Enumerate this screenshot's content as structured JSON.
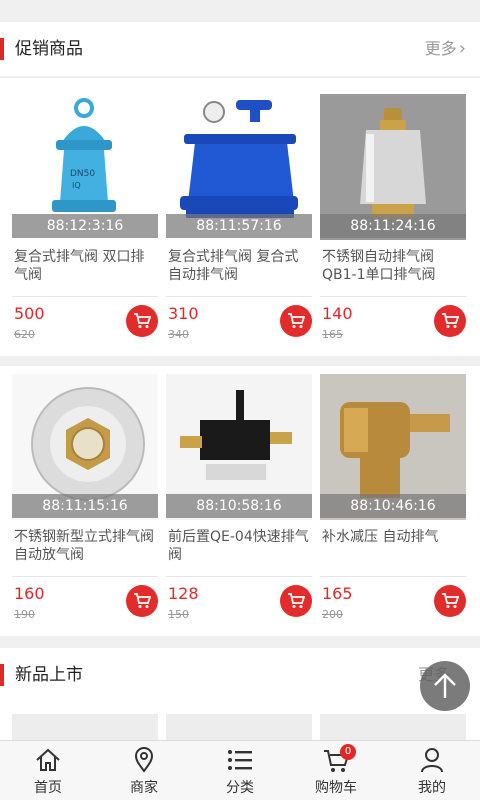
{
  "promo": {
    "title": "促销商品",
    "more": "更多",
    "items": [
      {
        "time": "88:11:57:16",
        "name": "复合式排气阀 复合式自动排气阀",
        "price": "310",
        "old_price": "340"
      },
      {
        "time": "88:11:24:16",
        "name": "不锈钢自动排气阀QB1-1单口排气阀",
        "price": "140",
        "old_price": "165"
      },
      {
        "time": "88:11:15:16",
        "name": "不锈钢新型立式排气阀自动放气阀",
        "price": "160",
        "old_price": "190"
      },
      {
        "time": "88:10:58:16",
        "name": "前后置QE-04快速排气阀",
        "price": "128",
        "old_price": "150"
      },
      {
        "time": "88:10:46:16",
        "name": "补水减压 自动排气",
        "price": "165",
        "old_price": "200"
      },
      {
        "time": "88:12:3:16",
        "name": "复合式排气阀 双口排气阀",
        "price": "500",
        "old_price": "620"
      }
    ]
  },
  "new": {
    "title": "新品上市",
    "more": "更多"
  },
  "tabbar": {
    "items": [
      {
        "label": "首页",
        "icon": "home-icon"
      },
      {
        "label": "商家",
        "icon": "location-pin-icon"
      },
      {
        "label": "分类",
        "icon": "list-icon"
      },
      {
        "label": "购物车",
        "icon": "cart-icon",
        "badge": "0"
      },
      {
        "label": "我的",
        "icon": "person-icon"
      }
    ]
  },
  "colors": {
    "accent": "#e02828",
    "price": "#e02828"
  }
}
